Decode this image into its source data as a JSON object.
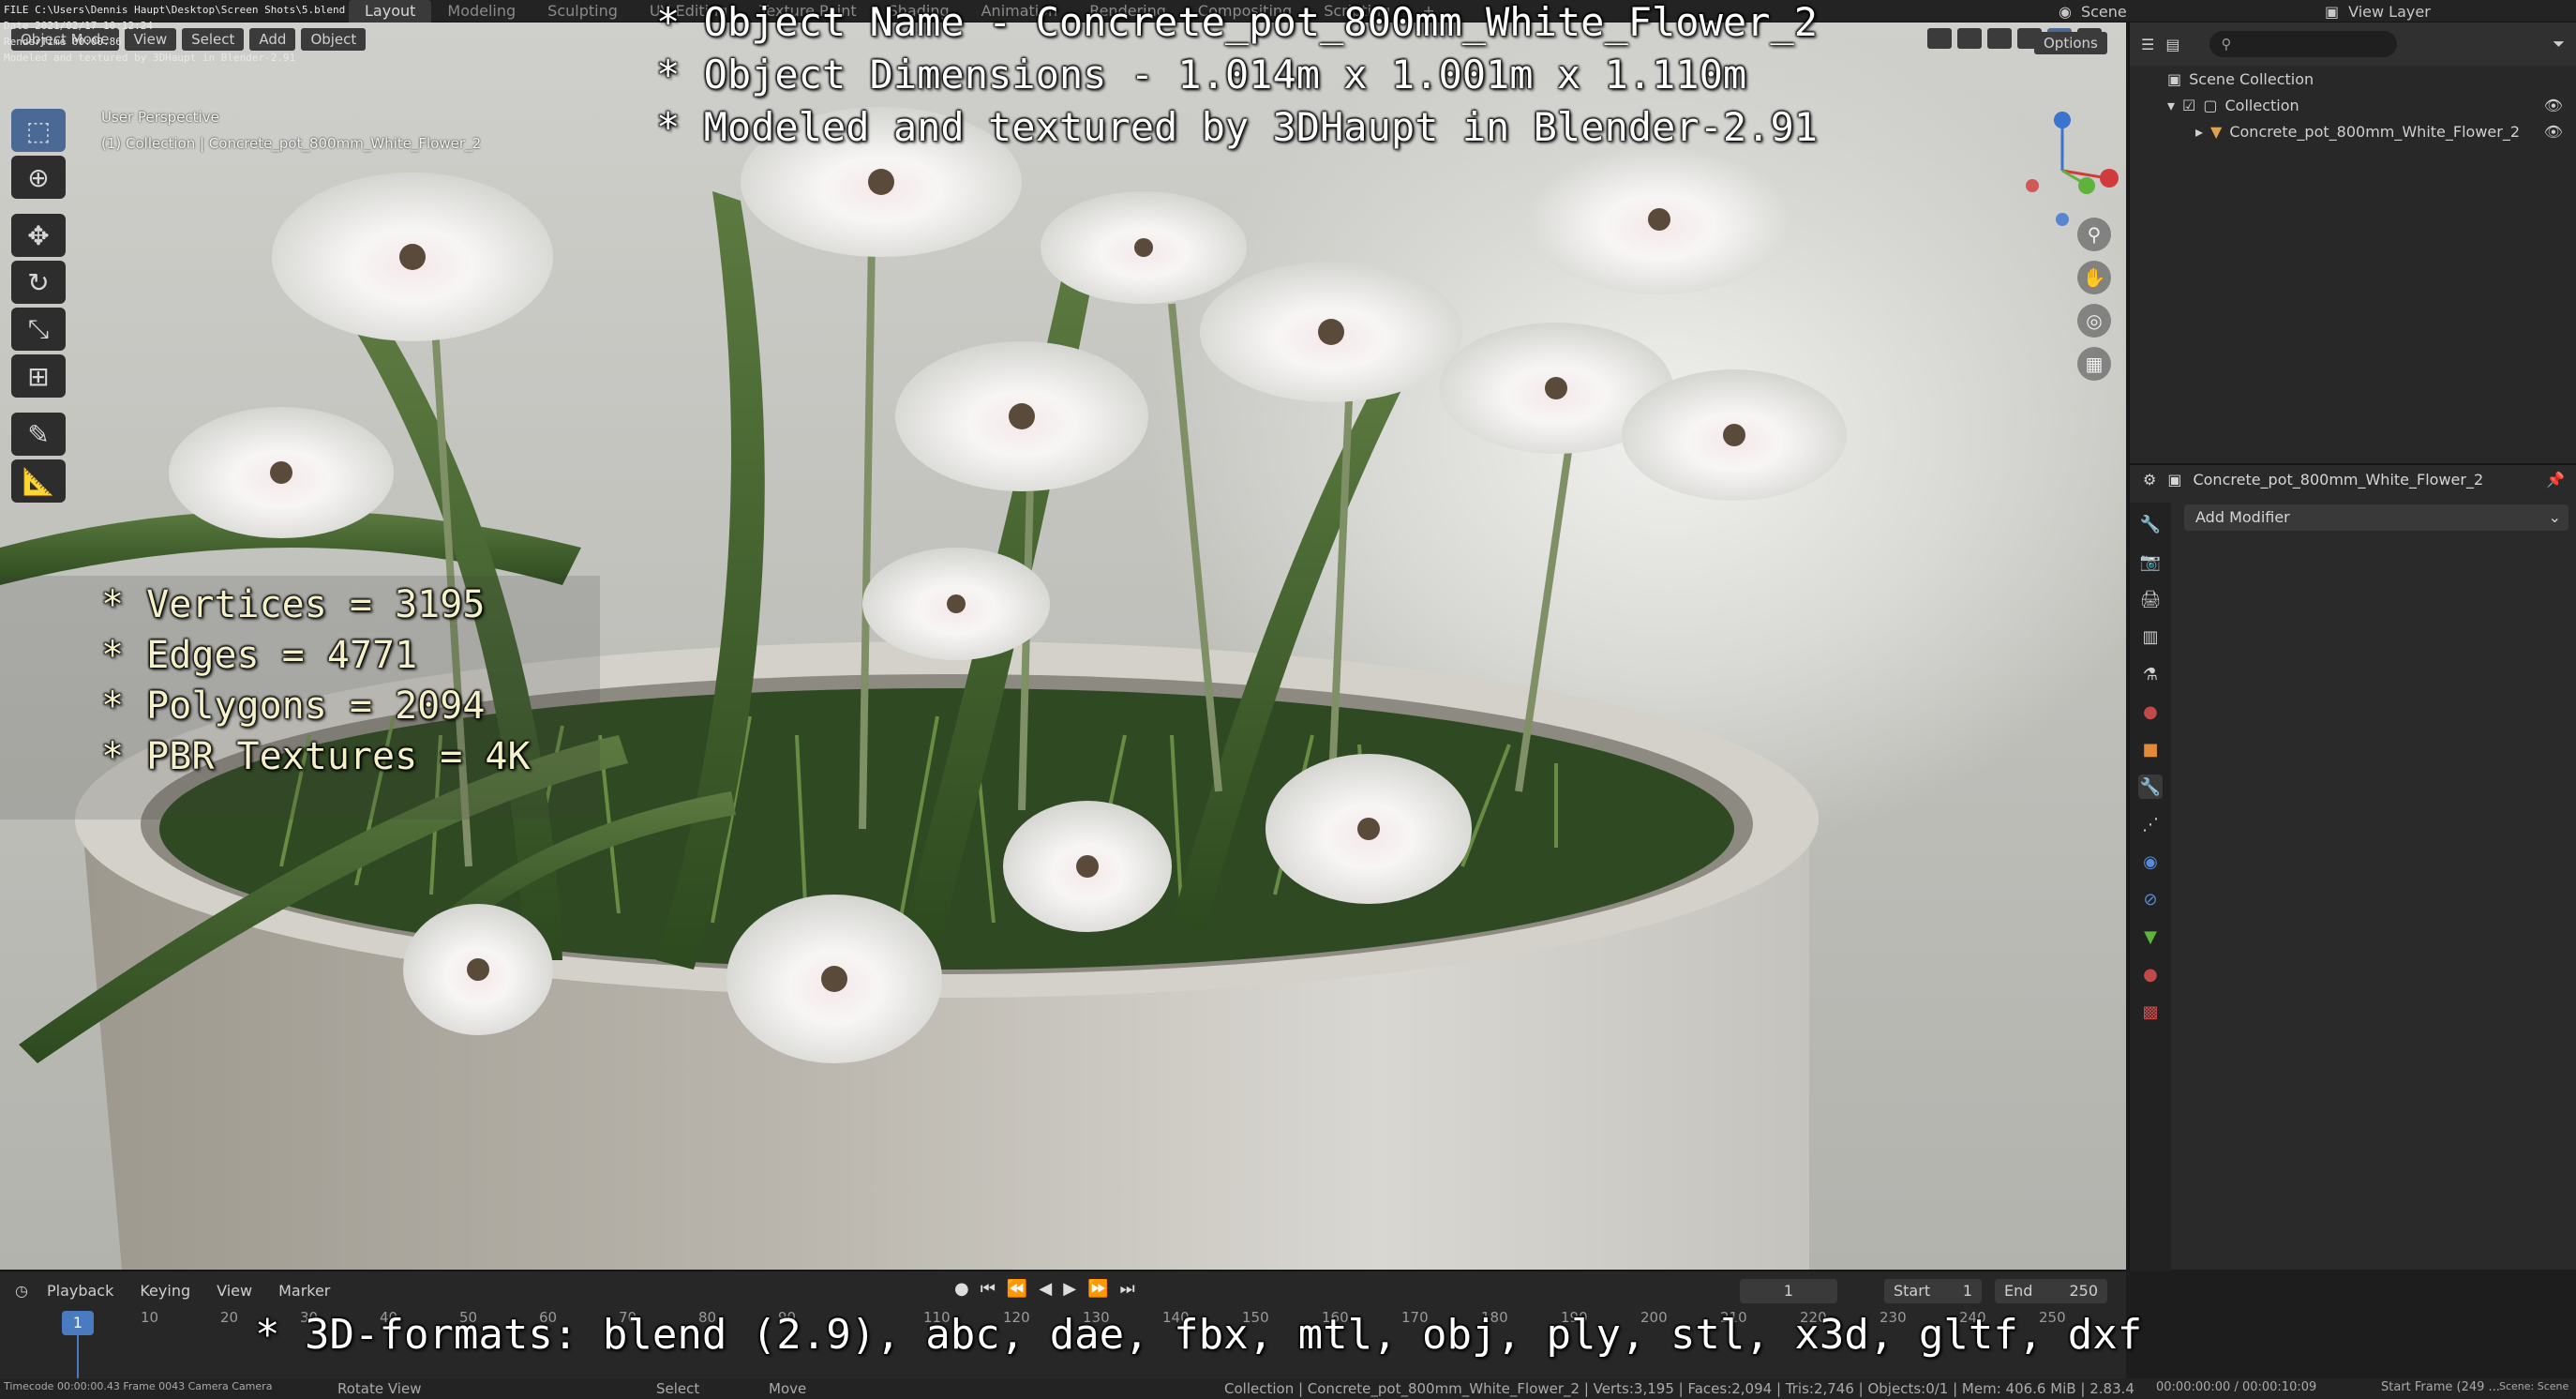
{
  "stamp": {
    "line1": "FILE C:\\Users\\Dennis Haupt\\Desktop\\Screen Shots\\5.blend",
    "line2": "Date 2021/02/17 10:12:24",
    "line3": "RenderTime 00:00.86",
    "line4": "Modeled and textured by 3DHaupt in Blender-2.91"
  },
  "workspaces": [
    "Layout",
    "Modeling",
    "Sculpting",
    "UV Editing",
    "Texture Paint",
    "Shading",
    "Animation",
    "Rendering",
    "Compositing",
    "Scripting"
  ],
  "active_workspace": "Layout",
  "add_workspace": "+",
  "scene_label": "Scene",
  "view_layer_label": "View Layer",
  "viewport": {
    "mode": "Object Mode",
    "menu": [
      "View",
      "Select",
      "Add",
      "Object"
    ],
    "options_label": "Options",
    "perspective": "User Perspective",
    "collection_label": "(1) Collection | Concrete_pot_800mm_White_Flower_2",
    "tools": [
      "cursor-select",
      "cursor-3d",
      "move",
      "rotate",
      "scale",
      "transform",
      "annotate",
      "measure"
    ]
  },
  "overlay_title": {
    "line1": "* Object Name - Concrete_pot_800mm_White_Flower_2",
    "line2": "* Object Dimensions -  1.014m x 1.001m x 1.110m",
    "line3": "* Modeled and textured by 3DHaupt in Blender-2.91"
  },
  "overlay_stats": {
    "vertices": "* Vertices = 3195",
    "edges": "* Edges = 4771",
    "polygons": "* Polygons = 2094",
    "textures": "* PBR Textures = 4K"
  },
  "overlay_formats": "* 3D-formats: blend (2.9), abc, dae, fbx, mtl, obj, ply, stl, x3d, gltf, dxf",
  "outliner": {
    "scene_collection": "Scene Collection",
    "collection": "Collection",
    "object": "Concrete_pot_800mm_White_Flower_2"
  },
  "properties": {
    "object_name": "Concrete_pot_800mm_White_Flower_2",
    "add_modifier": "Add Modifier"
  },
  "timeline": {
    "playback": "Playback",
    "keying": "Keying",
    "view": "View",
    "marker": "Marker",
    "current_frame": "1",
    "start_label": "Start",
    "start_value": "1",
    "end_label": "End",
    "end_value": "250",
    "ticks": [
      "10",
      "20",
      "30",
      "40",
      "50",
      "60",
      "70",
      "80",
      "90",
      "110",
      "120",
      "130",
      "140",
      "150",
      "160",
      "170",
      "180",
      "190",
      "200",
      "210",
      "220",
      "230",
      "240",
      "250"
    ]
  },
  "statusbar": {
    "timecode": "Timecode 00:00:00.43  Frame 0043  Camera Camera",
    "rotate": "Rotate View",
    "select": "Select",
    "move": "Move",
    "stats": "Collection | Concrete_pot_800mm_White_Flower_2 | Verts:3,195 | Faces:2,094 | Tris:2,746 | Objects:0/1 | Mem: 406.6 MiB | 2.83.4",
    "time": "00:00:00:00 / 00:00:10:09",
    "start_frame": "Start Frame (249 ...",
    "scene_name": "Scene: Scene"
  },
  "colors": {
    "accent": "#4a7bc0",
    "axis_x": "#d23b3b",
    "axis_y": "#5fb33d",
    "axis_z": "#3a73d0"
  }
}
